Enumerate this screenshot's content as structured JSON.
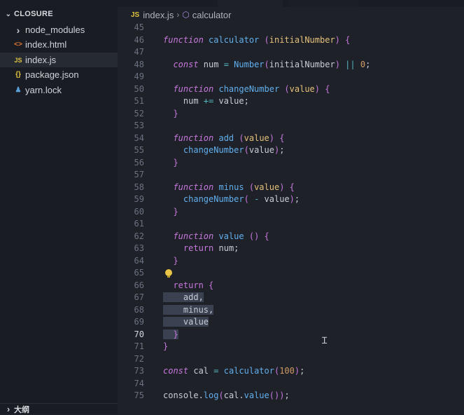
{
  "sidebar": {
    "title": "CLOSURE",
    "files": [
      {
        "name": "node_modules",
        "icon": "chevron-right-icon",
        "glyph": "›"
      },
      {
        "name": "index.html",
        "icon": "html-icon",
        "glyph": "<>"
      },
      {
        "name": "index.js",
        "icon": "js-icon",
        "glyph": "JS",
        "active": true
      },
      {
        "name": "package.json",
        "icon": "json-icon",
        "glyph": "{}"
      },
      {
        "name": "yarn.lock",
        "icon": "yarn-icon",
        "glyph": "♟"
      }
    ],
    "outline_label": "大纲"
  },
  "breadcrumb": {
    "badge": "JS",
    "file": "index.js",
    "symbol": "calculator"
  },
  "code": {
    "lines": [
      {
        "n": "45",
        "t": ""
      },
      {
        "n": "46",
        "t": "function calculator (initialNumber) {"
      },
      {
        "n": "47",
        "t": ""
      },
      {
        "n": "48",
        "t": "  const num = Number(initialNumber) || 0;"
      },
      {
        "n": "49",
        "t": ""
      },
      {
        "n": "50",
        "t": "  function changeNumber (value) {"
      },
      {
        "n": "51",
        "t": "    num += value;"
      },
      {
        "n": "52",
        "t": "  }"
      },
      {
        "n": "53",
        "t": ""
      },
      {
        "n": "54",
        "t": "  function add (value) {"
      },
      {
        "n": "55",
        "t": "    changeNumber(value);"
      },
      {
        "n": "56",
        "t": "  }"
      },
      {
        "n": "57",
        "t": ""
      },
      {
        "n": "58",
        "t": "  function minus (value) {"
      },
      {
        "n": "59",
        "t": "    changeNumber( - value);"
      },
      {
        "n": "60",
        "t": "  }"
      },
      {
        "n": "61",
        "t": ""
      },
      {
        "n": "62",
        "t": "  function value () {"
      },
      {
        "n": "63",
        "t": "    return num;"
      },
      {
        "n": "64",
        "t": "  }"
      },
      {
        "n": "65",
        "t": ""
      },
      {
        "n": "66",
        "t": "  return {"
      },
      {
        "n": "67",
        "t": "    add,"
      },
      {
        "n": "68",
        "t": "    minus,"
      },
      {
        "n": "69",
        "t": "    value"
      },
      {
        "n": "70",
        "t": "  }"
      },
      {
        "n": "71",
        "t": "}"
      },
      {
        "n": "72",
        "t": ""
      },
      {
        "n": "73",
        "t": "const cal = calculator(100);"
      },
      {
        "n": "74",
        "t": ""
      },
      {
        "n": "75",
        "t": "console.log(cal.value());"
      }
    ],
    "current_line": "70"
  },
  "colors": {
    "accent_js": "#e3c441",
    "keyword": "#c678dd",
    "function": "#61afef",
    "variable": "#e5c07b",
    "number": "#d19a66"
  }
}
